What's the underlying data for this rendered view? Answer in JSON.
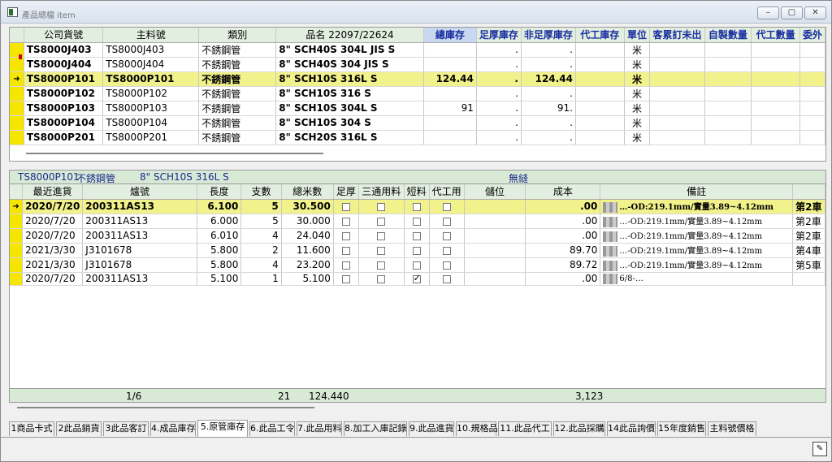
{
  "window": {
    "title": "產品總檔 item",
    "min": "–",
    "max": "▢",
    "close": "✕"
  },
  "upper": {
    "columns": [
      "公司貨號",
      "主料號",
      "類別",
      "品名 22097/22624",
      "總庫存",
      "足厚庫存",
      "非足厚庫存",
      "代工庫存",
      "單位",
      "客累訂未出",
      "自製數量",
      "代工數量",
      "委外"
    ],
    "rows": [
      {
        "marker": "",
        "code": "TS8000J403",
        "main": "TS8000J403",
        "cat": "不銹鋼管",
        "name": "8\" SCH40S 304L JIS S",
        "total": "",
        "full": ".",
        "nonfull": ".",
        "oem": "",
        "unit": "米"
      },
      {
        "marker": "",
        "code": "TS8000J404",
        "main": "TS8000J404",
        "cat": "不銹鋼管",
        "name": "8\" SCH40S 304 JIS S",
        "total": "",
        "full": ".",
        "nonfull": ".",
        "oem": "",
        "unit": "米"
      },
      {
        "marker": "➜",
        "code": "TS8000P101",
        "main": "TS8000P101",
        "cat": "不銹鋼管",
        "name": "8\" SCH10S 316L S",
        "total": "124.44",
        "full": ".",
        "nonfull": "124.44",
        "oem": "",
        "unit": "米",
        "active": true
      },
      {
        "marker": "",
        "code": "TS8000P102",
        "main": "TS8000P102",
        "cat": "不銹鋼管",
        "name": "8\" SCH10S 316 S",
        "total": "",
        "full": ".",
        "nonfull": ".",
        "oem": "",
        "unit": "米"
      },
      {
        "marker": "",
        "code": "TS8000P103",
        "main": "TS8000P103",
        "cat": "不銹鋼管",
        "name": "8\" SCH10S 304L S",
        "total": "91",
        "full": ".",
        "nonfull": "91.",
        "oem": "",
        "unit": "米"
      },
      {
        "marker": "",
        "code": "TS8000P104",
        "main": "TS8000P104",
        "cat": "不銹鋼管",
        "name": "8\" SCH10S 304 S",
        "total": "",
        "full": ".",
        "nonfull": ".",
        "oem": "",
        "unit": "米"
      },
      {
        "marker": "",
        "code": "TS8000P201",
        "main": "TS8000P201",
        "cat": "不銹鋼管",
        "name": "8\" SCH20S 316L S",
        "total": "",
        "full": ".",
        "nonfull": ".",
        "oem": "",
        "unit": "米"
      }
    ]
  },
  "lower_header": {
    "code": "TS8000P101",
    "cat": "不銹鋼管",
    "name": "8\" SCH10S 316L S",
    "type": "無縫"
  },
  "lower": {
    "columns": [
      "最近進貨",
      "爐號",
      "長度",
      "支數",
      "總米數",
      "足厚",
      "三通用料",
      "短料",
      "代工用",
      "儲位",
      "成本",
      "備註",
      ""
    ],
    "rows": [
      {
        "marker": "➜",
        "date": "2020/7/20",
        "heat": "200311AS13",
        "len": "6.100",
        "qty": "5",
        "meters": "30.500",
        "full": false,
        "tee": false,
        "short": false,
        "oem": false,
        "loc": "",
        "cost": ".00",
        "note": "…-OD:219.1mm/實量3.89~4.12mm",
        "car": "第2車",
        "active": true
      },
      {
        "marker": "",
        "date": "2020/7/20",
        "heat": "200311AS13",
        "len": "6.000",
        "qty": "5",
        "meters": "30.000",
        "full": false,
        "tee": false,
        "short": false,
        "oem": false,
        "loc": "",
        "cost": ".00",
        "note": "…-OD:219.1mm/實量3.89~4.12mm",
        "car": "第2車"
      },
      {
        "marker": "",
        "date": "2020/7/20",
        "heat": "200311AS13",
        "len": "6.010",
        "qty": "4",
        "meters": "24.040",
        "full": false,
        "tee": false,
        "short": false,
        "oem": false,
        "loc": "",
        "cost": ".00",
        "note": "…-OD:219.1mm/實量3.89~4.12mm",
        "car": "第2車"
      },
      {
        "marker": "",
        "date": "2021/3/30",
        "heat": "J3101678",
        "len": "5.800",
        "qty": "2",
        "meters": "11.600",
        "full": false,
        "tee": false,
        "short": false,
        "oem": false,
        "loc": "",
        "cost": "89.70",
        "note": "…-OD:219.1mm/實量3.89~4.12mm",
        "car": "第4車"
      },
      {
        "marker": "",
        "date": "2021/3/30",
        "heat": "J3101678",
        "len": "5.800",
        "qty": "4",
        "meters": "23.200",
        "full": false,
        "tee": false,
        "short": false,
        "oem": false,
        "loc": "",
        "cost": "89.72",
        "note": "…-OD:219.1mm/實量3.89~4.12mm",
        "car": "第5車"
      },
      {
        "marker": "",
        "date": "2020/7/20",
        "heat": "200311AS13",
        "len": "5.100",
        "qty": "1",
        "meters": "5.100",
        "full": false,
        "tee": false,
        "short": true,
        "oem": false,
        "loc": "",
        "cost": ".00",
        "note": "6/8-…",
        "car": ""
      }
    ]
  },
  "totals": {
    "page": "1/6",
    "qty": "21",
    "meters": "124.440",
    "cost": "3,123"
  },
  "tabs": [
    "1商品卡式",
    "2此品銷貨",
    "3此品客訂",
    "4.成品庫存",
    "5.原管庫存",
    "6.此品工令",
    "7.此品用料",
    "8.加工入庫記錄",
    "9.此品進貨",
    "10.規格品",
    "11.此品代工",
    "12.此品採購",
    "14此品詢價",
    "15年度銷售",
    "主料號價格"
  ],
  "active_tab": "5.原管庫存"
}
